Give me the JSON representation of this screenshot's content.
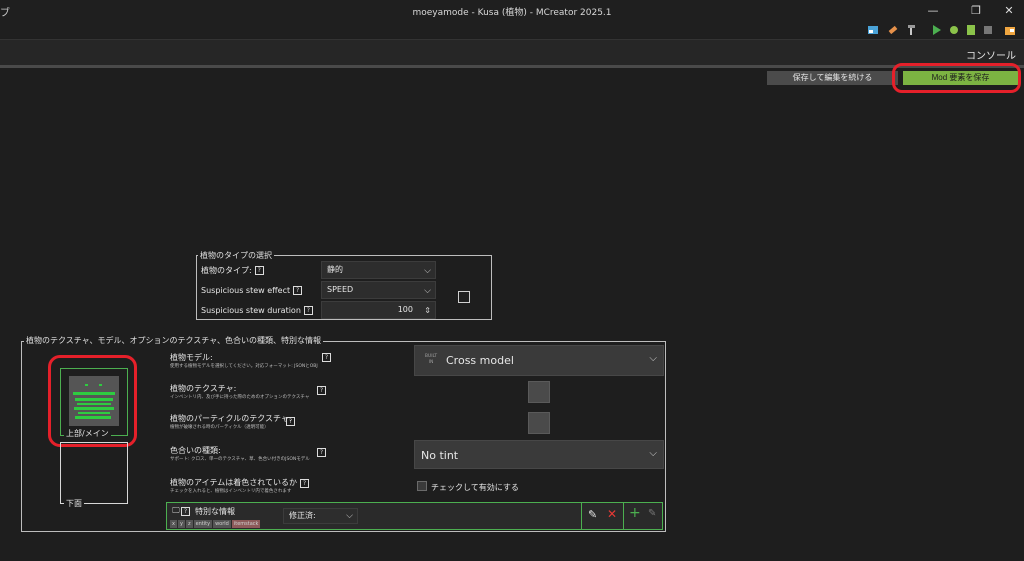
{
  "window": {
    "title": "moeyamode - Kusa (植物) - MCreator 2025.1",
    "app_glyph": "ブ"
  },
  "console": {
    "label": "コンソール"
  },
  "actions": {
    "continue_label": "保存して編集を続ける",
    "save_label": "Mod 要素を保存"
  },
  "plant_type": {
    "legend": "植物のタイプの選択",
    "type_label": "植物のタイプ:",
    "type_value": "静的",
    "stew_effect_label": "Suspicious stew effect",
    "stew_effect_value": "SPEED",
    "stew_duration_label": "Suspicious stew duration",
    "stew_duration_value": "100"
  },
  "textures": {
    "legend": "植物のテクスチャ、モデル、オプションのテクスチャ、色合いの種類、特別な情報",
    "top_label": "上部/メイン",
    "bottom_label": "下面"
  },
  "params": {
    "model_title": "植物モデル:",
    "model_desc": "使用する植物モデルを選択してください。対応フォーマット: JSONとOBJ",
    "model_value": "Cross model",
    "model_badge_top": "BUILT",
    "model_badge_bottom": "IN",
    "texture_title": "植物のテクスチャ:",
    "texture_desc": "インベントリ内、及び手に持った際のためのオプションのテクスチャ",
    "particle_title": "植物のパーティクルのテクスチャ:",
    "particle_desc": "植物が破壊される時のパーティクル（透明可能）",
    "tint_title": "色合いの種類:",
    "tint_desc": "サポート: クロス、単一のテクスチャ、草、色合い付きのJSONモデル",
    "tint_value": "No tint",
    "item_tint_title": "植物のアイテムは着色されているか",
    "item_tint_desc": "チェックを入れると、植物はインベントリ内で着色されます",
    "item_tint_check_label": "チェックして有効にする"
  },
  "procedure": {
    "title": "特別な情報",
    "tags": [
      "x",
      "y",
      "z",
      "entity",
      "world",
      "itemstack"
    ],
    "dropdown_value": "修正済:"
  }
}
